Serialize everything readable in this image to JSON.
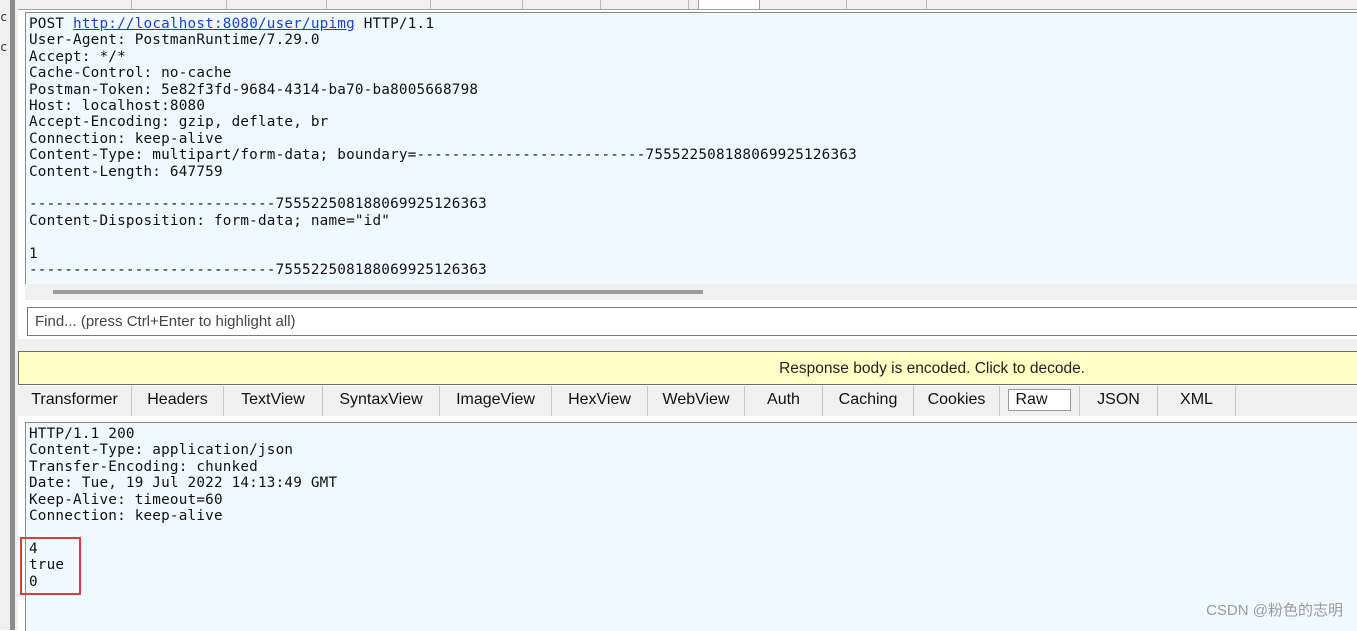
{
  "gutter": {
    "glyph1": "c",
    "glyph2": "c"
  },
  "request": {
    "method": "POST",
    "url": "http://localhost:8080/user/upimg",
    "protocol": "HTTP/1.1",
    "headers": [
      "User-Agent: PostmanRuntime/7.29.0",
      "Accept: */*",
      "Cache-Control: no-cache",
      "Postman-Token: 5e82f3fd-9684-4314-ba70-ba8005668798",
      "Host: localhost:8080",
      "Accept-Encoding: gzip, deflate, br",
      "Connection: keep-alive",
      "Content-Type: multipart/form-data; boundary=--------------------------755522508188069925126363",
      "Content-Length: 647759"
    ],
    "body_lines": [
      "",
      "----------------------------755522508188069925126363",
      "Content-Disposition: form-data; name=\"id\"",
      "",
      "1",
      "----------------------------755522508188069925126363"
    ]
  },
  "find": {
    "placeholder": "Find... (press Ctrl+Enter to highlight all)"
  },
  "banner": {
    "text": "Response body is encoded. Click to decode."
  },
  "response_tabs": {
    "items": [
      "Transformer",
      "Headers",
      "TextView",
      "SyntaxView",
      "ImageView",
      "HexView",
      "WebView",
      "Auth",
      "Caching",
      "Cookies",
      "Raw",
      "JSON",
      "XML"
    ],
    "active": "Raw"
  },
  "response": {
    "lines": [
      "HTTP/1.1 200",
      "Content-Type: application/json",
      "Transfer-Encoding: chunked",
      "Date: Tue, 19 Jul 2022 14:13:49 GMT",
      "Keep-Alive: timeout=60",
      "Connection: keep-alive",
      "",
      "4",
      "true",
      "0"
    ]
  },
  "watermark": "CSDN @粉色的志明",
  "colors": {
    "text_panel_bg": "#f0f9ff",
    "banner_bg": "#ffffc6",
    "highlight_box": "#e03a3a",
    "link": "#1a3fd8"
  }
}
